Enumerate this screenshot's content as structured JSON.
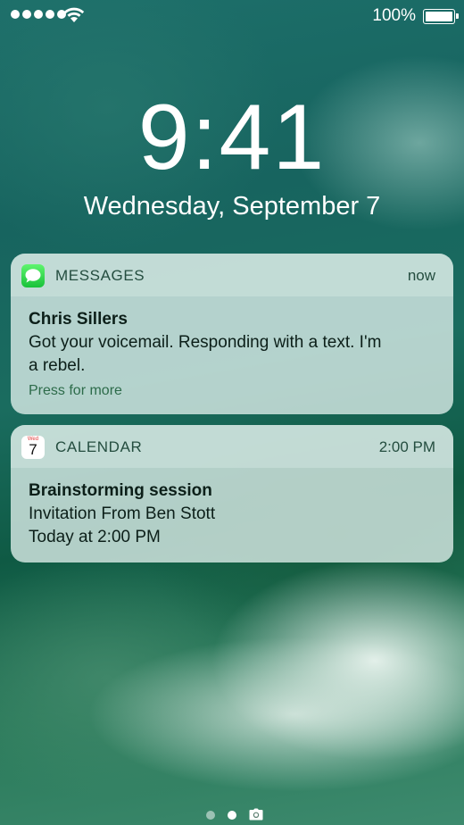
{
  "status": {
    "battery_text": "100%",
    "signal_dots": 5
  },
  "lock": {
    "time": "9:41",
    "date": "Wednesday, September 7"
  },
  "notifications": [
    {
      "app": "MESSAGES",
      "icon": "messages-icon",
      "time": "now",
      "title": "Chris Sillers",
      "lines": [
        "Got your voicemail. Responding with a text. I'm",
        "a rebel."
      ],
      "action": "Press for more"
    },
    {
      "app": "CALENDAR",
      "icon": "calendar-icon",
      "icon_day": "Wed",
      "icon_date": "7",
      "time": "2:00 PM",
      "title": "Brainstorming session",
      "lines": [
        "Invitation From Ben Stott",
        "Today at 2:00 PM"
      ]
    }
  ],
  "pager": {
    "pages": 2,
    "current": 2
  },
  "colors": {
    "accent_green": "#2d6b4a",
    "card_bg": "#e0f0ec"
  }
}
